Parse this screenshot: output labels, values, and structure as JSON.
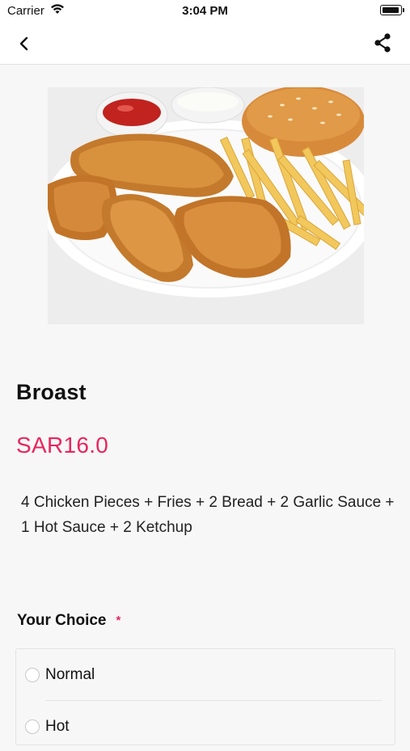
{
  "status_bar": {
    "carrier": "Carrier",
    "time": "3:04 PM"
  },
  "nav": {
    "back_icon": "chevron-left-icon",
    "share_icon": "share-icon"
  },
  "product": {
    "image_alt": "broast meal",
    "title": "Broast",
    "price": "SAR16.0",
    "description": "4 Chicken Pieces + Fries + 2 Bread + 2 Garlic Sauce + 1 Hot Sauce + 2 Ketchup"
  },
  "choice": {
    "header": "Your Choice",
    "required_marker": "*",
    "options": [
      {
        "label": "Normal",
        "selected": false
      },
      {
        "label": "Hot",
        "selected": false
      }
    ]
  },
  "colors": {
    "accent": "#e8265e",
    "background": "#f7f7f7"
  }
}
